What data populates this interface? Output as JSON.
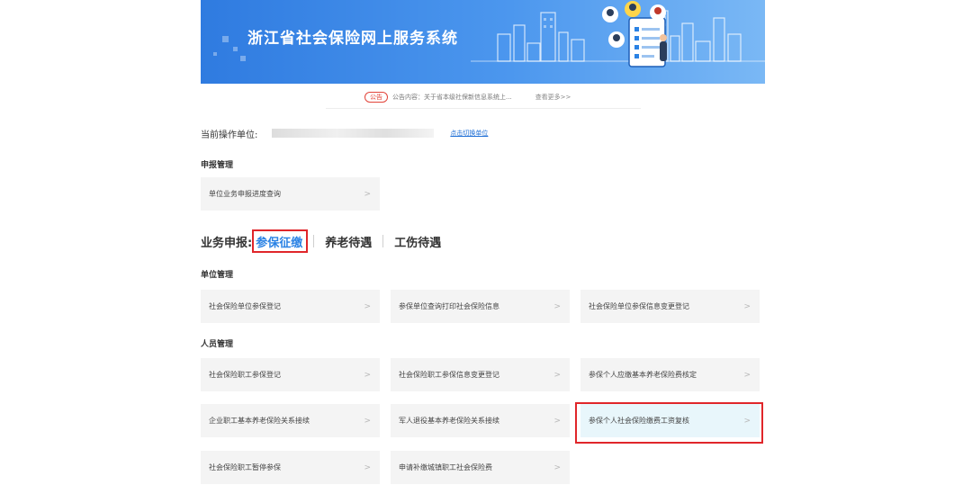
{
  "banner": {
    "title": "浙江省社会保险网上服务系统"
  },
  "notice": {
    "badge": "公告",
    "text": "公告内容：关于省本级社保新信息系统上...",
    "more": "查看更多>>"
  },
  "unit": {
    "label": "当前操作单位:",
    "switch_link": "点击切换单位"
  },
  "declare": {
    "title": "申报管理",
    "items": [
      {
        "label": "单位业务申报进度查询"
      }
    ]
  },
  "business": {
    "label": "业务申报:",
    "tabs": [
      {
        "label": "参保征缴"
      },
      {
        "label": "养老待遇"
      },
      {
        "label": "工伤待遇"
      }
    ],
    "active_tab": "参保征缴"
  },
  "unit_mgmt": {
    "title": "单位管理",
    "items": [
      {
        "label": "社会保险单位参保登记"
      },
      {
        "label": "参保单位查询打印社会保险信息"
      },
      {
        "label": "社会保险单位参保信息变更登记"
      }
    ]
  },
  "person_mgmt": {
    "title": "人员管理",
    "items": [
      {
        "label": "社会保险职工参保登记"
      },
      {
        "label": "社会保险职工参保信息变更登记"
      },
      {
        "label": "参保个人应缴基本养老保险费核定"
      },
      {
        "label": "企业职工基本养老保险关系接续"
      },
      {
        "label": "军人退役基本养老保险关系接续"
      },
      {
        "label": "参保个人社会保险缴费工资复核"
      },
      {
        "label": "社会保险职工暂停参保"
      },
      {
        "label": "申请补缴城镇职工社会保险费"
      }
    ]
  },
  "arrow_glyph": ">",
  "colors": {
    "accent": "#2a82e4",
    "highlight": "#e0262a",
    "banner": "#3f8ce8"
  },
  "icons": [
    "city-skyline-icon",
    "people-avatars-icon",
    "checklist-board-icon"
  ]
}
